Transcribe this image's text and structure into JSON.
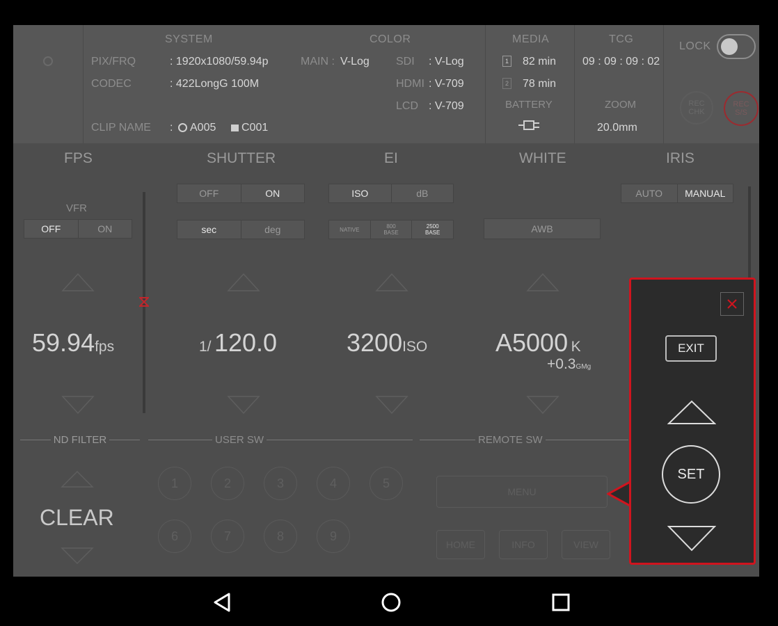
{
  "top": {
    "system": {
      "heading": "SYSTEM",
      "pixfrq_label": "PIX/FRQ",
      "pixfrq_value": ": 1920x1080/59.94p",
      "codec_label": "CODEC",
      "codec_value": ": 422LongG 100M",
      "clipname_label": "CLIP NAME",
      "clipname_sep": ":",
      "reel": "A005",
      "clip": "C001"
    },
    "color": {
      "heading": "COLOR",
      "main_label": "MAIN :",
      "main_value": "V-Log",
      "sdi_label": "SDI",
      "sdi_value": ": V-Log",
      "hdmi_label": "HDMI",
      "hdmi_value": ": V-709",
      "lcd_label": "LCD",
      "lcd_value": ": V-709"
    },
    "media": {
      "heading": "MEDIA",
      "slot1_num": "1",
      "slot1_value": "82 min",
      "slot2_num": "2",
      "slot2_value": "78 min",
      "battery_label": "BATTERY"
    },
    "tcg": {
      "heading": "TCG",
      "value": "09 : 09 : 09 : 02",
      "zoom_label": "ZOOM",
      "zoom_value": "20.0mm"
    },
    "lock_label": "LOCK",
    "rec_chk_line1": "REC",
    "rec_chk_line2": "CHK",
    "rec_ss_line1": "REC",
    "rec_ss_line2": "S/S"
  },
  "fps": {
    "heading": "FPS",
    "vfr_label": "VFR",
    "off": "OFF",
    "on": "ON",
    "value": "59.94",
    "unit": "fps"
  },
  "shutter": {
    "heading": "SHUTTER",
    "off": "OFF",
    "on": "ON",
    "sec": "sec",
    "deg": "deg",
    "prefix": "1/",
    "value": "120.0"
  },
  "ei": {
    "heading": "EI",
    "iso": "ISO",
    "db": "dB",
    "native": "NATIVE",
    "b800_1": "800",
    "b800_2": "BASE",
    "b2500_1": "2500",
    "b2500_2": "BASE",
    "value": "3200",
    "unit": "ISO"
  },
  "white": {
    "heading": "WHITE",
    "awb": "AWB",
    "value": "A5000",
    "unit": "K",
    "offset": "+0.3",
    "offset_unit": "GMg"
  },
  "iris": {
    "heading": "IRIS",
    "auto": "AUTO",
    "manual": "MANUAL"
  },
  "nd": {
    "heading": "ND FILTER",
    "value": "CLEAR"
  },
  "user_sw": {
    "heading": "USER SW",
    "buttons": [
      "1",
      "2",
      "3",
      "4",
      "5",
      "6",
      "7",
      "8",
      "9"
    ]
  },
  "remote_sw": {
    "heading": "REMOTE SW",
    "menu": "MENU",
    "home": "HOME",
    "info": "INFO",
    "view": "VIEW"
  },
  "overlay": {
    "exit": "EXIT",
    "set": "SET"
  },
  "colors": {
    "accent_red": "#d0141e",
    "panel_bg": "#4d4d4d",
    "overlay_bg": "#2b2b2b"
  }
}
